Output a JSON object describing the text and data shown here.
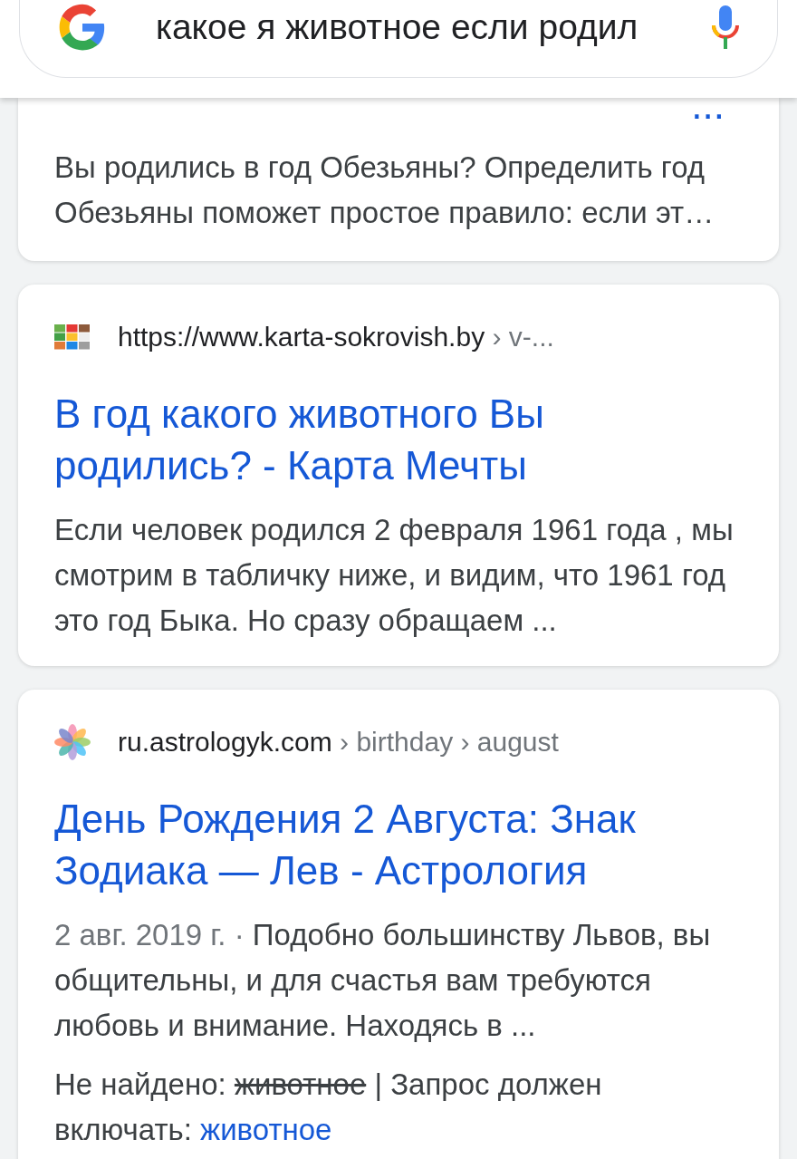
{
  "search": {
    "query": "какое я животное если родил"
  },
  "results": [
    {
      "kind": "partial",
      "title": "...",
      "snippet": "Вы родились в год Обезьяны? Определить год Обезьяны поможет простое правило: если эт…"
    },
    {
      "kind": "full",
      "favicon": {
        "kind": "tiles"
      },
      "url": "https://www.karta-sokrovish.by",
      "path": "› v-...",
      "title": "В год какого животного Вы родились? - Карта Мечты",
      "snippet": "Если человек родился 2 февраля 1961 года , мы смотрим в табличку ниже, и видим, что 1961 год это год Быка. Но сразу обращаем  ..."
    },
    {
      "kind": "full",
      "favicon": {
        "kind": "flower"
      },
      "url": "ru.astrologyk.com",
      "path": "› birthday › august",
      "title": "День Рождения 2 Августа: Знак Зодиака — Лев - Астрология",
      "date": "2 авг. 2019 г. ·",
      "snippet": "Подобно большинству Львов, вы общительны, и для счастья вам требуются любовь и внимание. Находясь в  ...",
      "missing": {
        "label": "Не найдено:",
        "term": "животное",
        "required_label": "| Запрос должен включать:",
        "required_term": "животное"
      }
    }
  ]
}
